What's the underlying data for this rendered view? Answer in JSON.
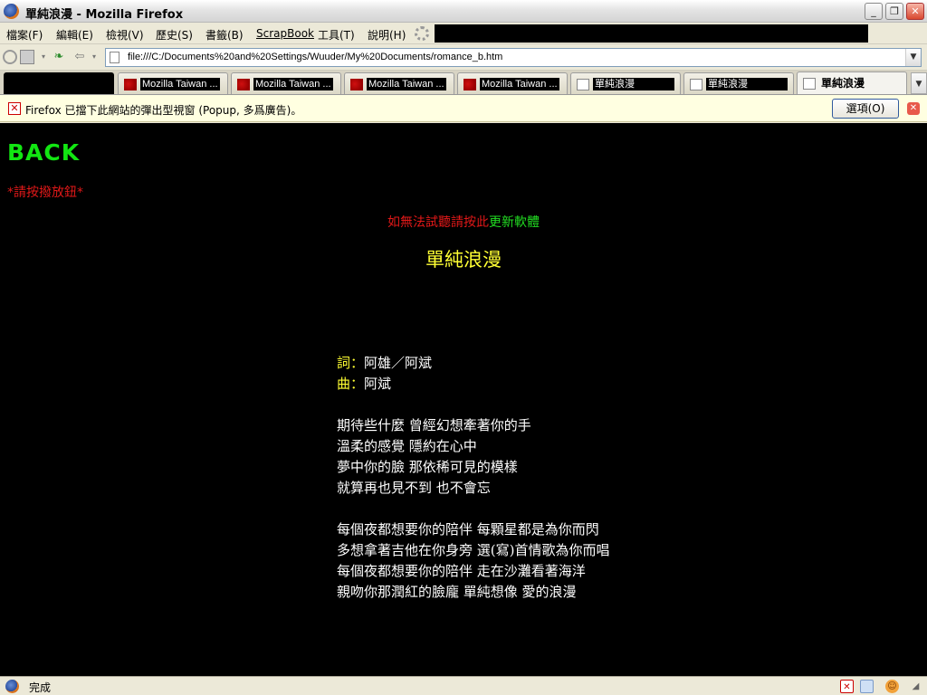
{
  "window": {
    "title": "單純浪漫 - Mozilla Firefox",
    "minimize_glyph": "_",
    "restore_glyph": "❐",
    "close_glyph": "✕"
  },
  "menu": {
    "items": [
      "檔案(F)",
      "編輯(E)",
      "檢視(V)",
      "歷史(S)",
      "書籤(B)",
      "ScrapBook",
      "工具(T)",
      "說明(H)"
    ]
  },
  "navigation": {
    "url": "file:///C:/Documents%20and%20Settings/Wuuder/My%20Documents/romance_b.htm",
    "back_glyph": "⇦",
    "forward_glyph": "⇨"
  },
  "tabs": [
    {
      "label": "Mozilla Taiwan ...",
      "icon": "mozilla-dino-icon"
    },
    {
      "label": "Mozilla Taiwan ...",
      "icon": "mozilla-dino-icon"
    },
    {
      "label": "Mozilla Taiwan ...",
      "icon": "mozilla-dino-icon"
    },
    {
      "label": "Mozilla Taiwan ...",
      "icon": "mozilla-dino-icon"
    },
    {
      "label": "單純浪漫",
      "icon": "page-icon"
    },
    {
      "label": "單純浪漫",
      "icon": "page-icon"
    },
    {
      "label": "單純浪漫",
      "icon": "page-icon",
      "active": true
    }
  ],
  "popup_bar": {
    "message": "Firefox 已擋下此網站的彈出型視窗 (Popup, 多爲廣告)。",
    "options_button": "選項(O)",
    "icon_glyph": "✕"
  },
  "page": {
    "back_link": "BACK",
    "play_hint": "*請按撥放鈕*",
    "update_prefix": "如無法試聽請按此",
    "update_link": "更新軟體",
    "song_title": "單純浪漫",
    "lyricist_label": "詞：",
    "lyricist": "阿雄／阿斌",
    "composer_label": "曲：",
    "composer": "阿斌",
    "verse1": [
      "期待些什麼 曾經幻想牽著你的手",
      "溫柔的感覺 隱約在心中",
      "夢中你的臉 那依稀可見的模樣",
      "就算再也見不到 也不會忘"
    ],
    "verse2": [
      "每個夜都想要你的陪伴 每顆星都是為你而閃",
      "多想拿著吉他在你身旁 選(寫)首情歌為你而唱",
      "每個夜都想要你的陪伴 走在沙灘看著海洋",
      "親吻你那潤紅的臉龐 單純想像 愛的浪漫"
    ]
  },
  "status": {
    "text": "完成"
  },
  "colors": {
    "content_bg": "#000000",
    "back_link": "#12e612",
    "hint_red": "#e01818",
    "title_yellow": "#ffff33",
    "lyrics_white": "#ffffff"
  }
}
